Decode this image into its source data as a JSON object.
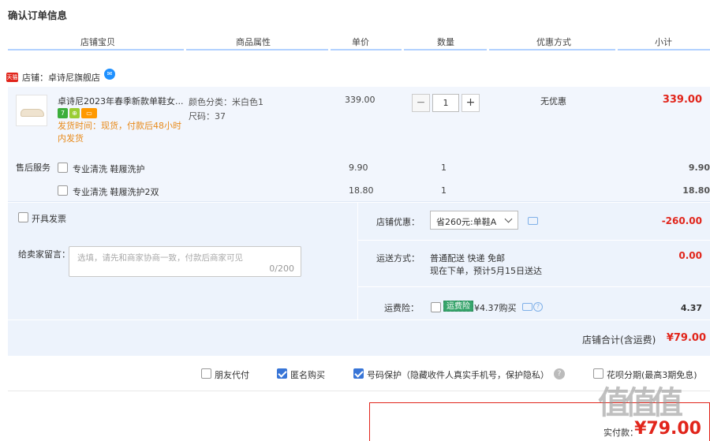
{
  "page_title": "确认订单信息",
  "columns": [
    "店铺宝贝",
    "商品属性",
    "单价",
    "数量",
    "优惠方式",
    "小计"
  ],
  "shop": {
    "tag": "天猫",
    "label": "店铺：卓诗尼旗舰店"
  },
  "item": {
    "title": "卓诗尼2023年春季新款单鞋女...",
    "badges": [
      "7",
      "⊕",
      "▭"
    ],
    "ship_time": "发货时间：现货，付款后48小时内发货",
    "color_attr": "颜色分类：米白色1",
    "size_attr": "尺码：37",
    "unit_price": "339.00",
    "qty": "1",
    "discount": "无优惠",
    "subtotal": "339.00"
  },
  "services": {
    "label": "售后服务",
    "rows": [
      {
        "name": "专业清洗 鞋履洗护",
        "price": "9.90",
        "qty": "1",
        "total": "9.90"
      },
      {
        "name": "专业清洗 鞋履洗护2双",
        "price": "18.80",
        "qty": "1",
        "total": "18.80"
      }
    ]
  },
  "invoice_label": "开具发票",
  "message": {
    "label": "给卖家留言：",
    "placeholder": "选填，请先和商家协商一致，付款后商家可见",
    "counter": "0/200"
  },
  "shop_discount": {
    "label": "店铺优惠：",
    "selected": "省260元:单鞋A",
    "amount": "-260.00"
  },
  "shipping": {
    "label": "运送方式：",
    "method": "普通配送 快递 免邮",
    "eta": "现在下单，预计5月15日送达",
    "amount": "0.00"
  },
  "freight_insurance": {
    "label": "运费险：",
    "tag": "运费险",
    "text": "¥4.37购买",
    "amount": "4.37"
  },
  "shop_total": {
    "label": "店铺合计(含运费)",
    "value": "¥79.00"
  },
  "options": {
    "friend_pay": "朋友代付",
    "anonymous": "匿名购买",
    "number_protect": "号码保护（隐藏收件人真实手机号，保护隐私）",
    "huabei": "花呗分期(最高3期免息)"
  },
  "pay": {
    "label": "实付款：",
    "value": "¥79.00"
  },
  "watermark": "值值值",
  "colors": {
    "accent": "#e1251b",
    "header_line": "#b2d1ff",
    "panel": "#edf3fc",
    "orange": "#e88a1a"
  }
}
